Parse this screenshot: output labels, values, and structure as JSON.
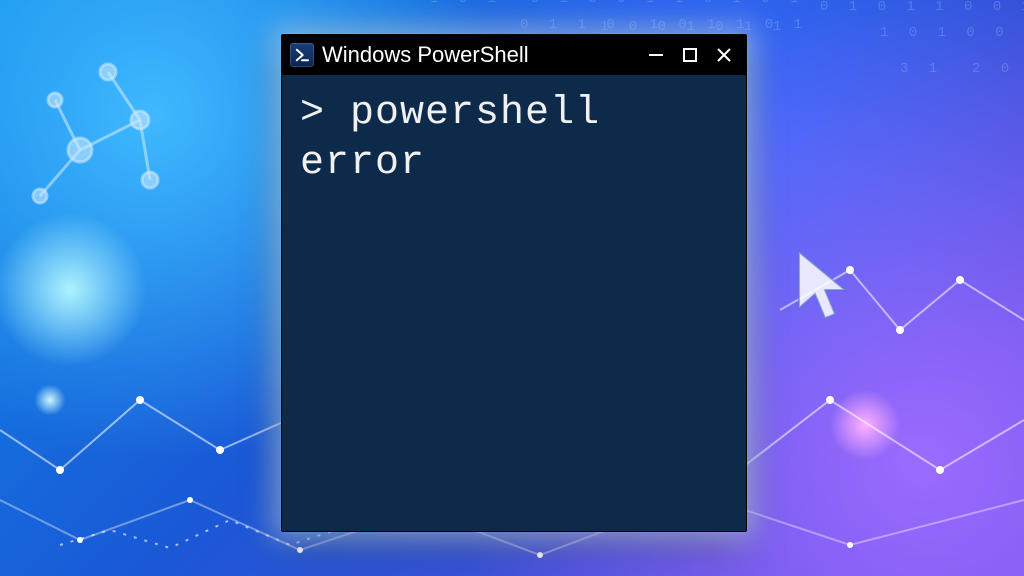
{
  "window": {
    "title": "Windows PowerShell",
    "controls": {
      "minimize": "Minimize",
      "maximize": "Maximize",
      "close": "Close"
    }
  },
  "terminal": {
    "prompt": ">",
    "line1": "powershell",
    "line2": "error"
  },
  "colors": {
    "terminal_bg": "#0e2a4a",
    "terminal_fg": "#f0f0f0",
    "titlebar_bg": "#000000"
  }
}
